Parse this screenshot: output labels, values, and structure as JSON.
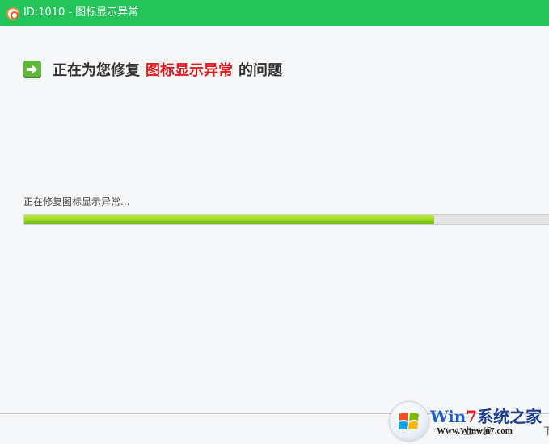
{
  "window": {
    "title": "ID:1010 - 图标显示异常",
    "app_icon": "lifebuoy-icon"
  },
  "heading": {
    "icon": "arrow-right-icon",
    "prefix": "正在为您修复",
    "highlight": "图标显示异常",
    "suffix": "的问题",
    "highlight_color": "#e01c1c"
  },
  "status": {
    "text": "正在修复图标显示异常...",
    "progress_fraction": 0.77
  },
  "footer": {
    "prev_label": "上一步",
    "next_label": "下"
  },
  "watermark": {
    "brand_w": "W",
    "brand_in": "in",
    "brand_7": "7",
    "brand_rest": "系统之家",
    "url": "Www.Winwin7.com",
    "logo_icon": "windows-logo-icon"
  },
  "colors": {
    "titlebar": "#23c55b",
    "accent_green": "#5fb83a",
    "progress_fill": "#9ad51a"
  }
}
